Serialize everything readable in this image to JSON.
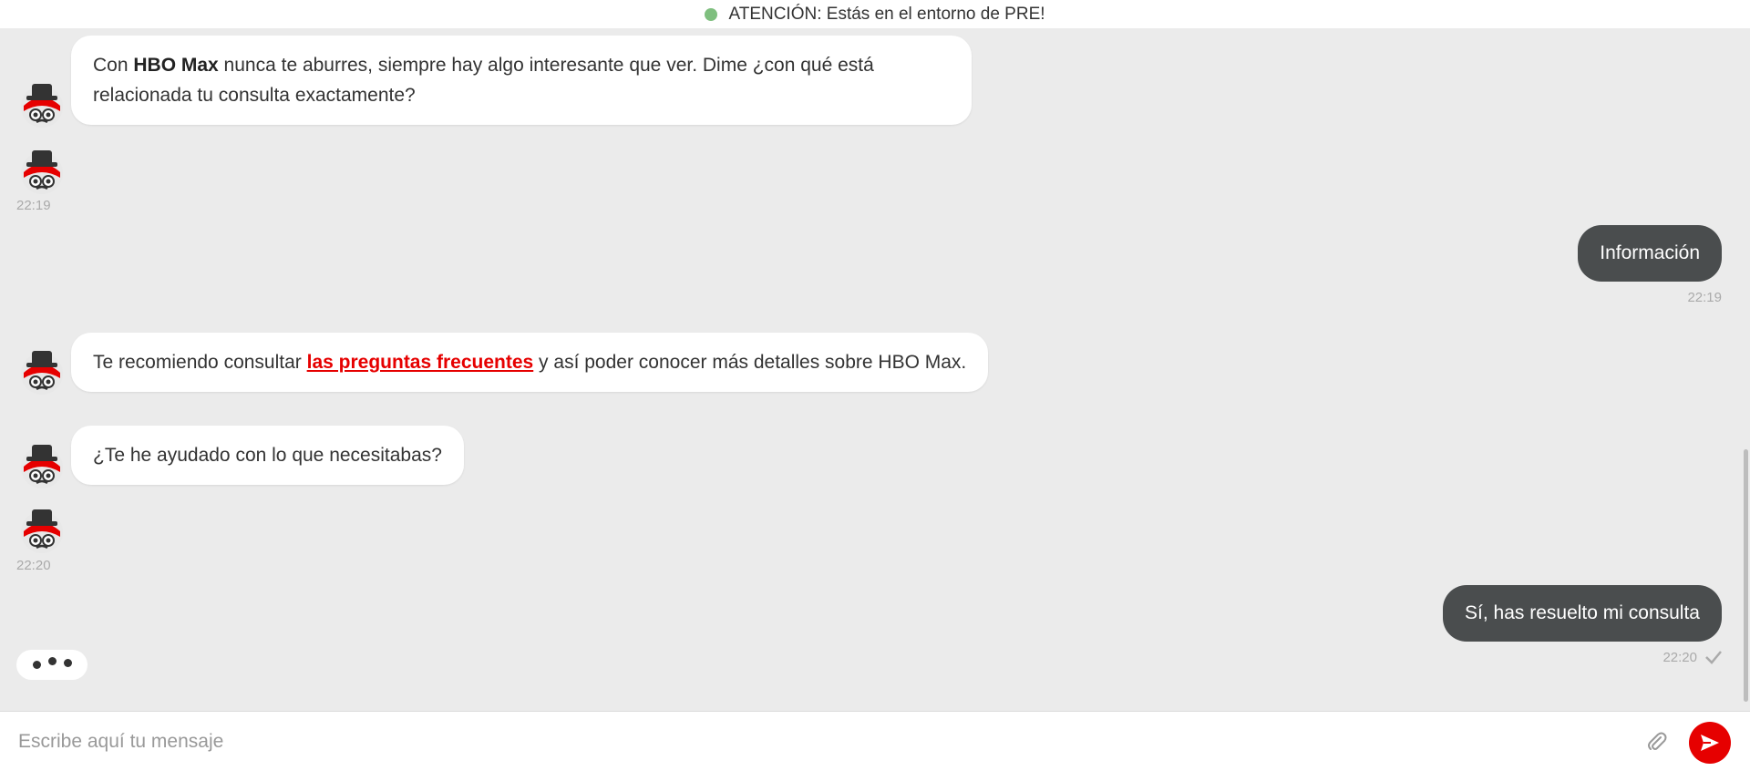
{
  "banner": {
    "text": "ATENCIÓN: Estás en el entorno de PRE!",
    "status_color": "#7fbf7f"
  },
  "messages": [
    {
      "from": "bot",
      "parts": [
        {
          "text": "Con "
        },
        {
          "text": "HBO Max",
          "bold": true
        },
        {
          "text": " nunca te aburres, siempre hay algo interesante que ver. Dime ¿con qué está relacionada tu consulta exactamente?"
        }
      ]
    },
    {
      "from": "bot",
      "time": "22:19"
    },
    {
      "from": "user",
      "text": "Información",
      "time": "22:19"
    },
    {
      "from": "bot",
      "parts": [
        {
          "text": "Te recomiendo consultar "
        },
        {
          "text": "las preguntas frecuentes",
          "link": true
        },
        {
          "text": " y así poder conocer más detalles sobre HBO Max."
        }
      ]
    },
    {
      "from": "bot",
      "text": "¿Te he ayudado con lo que necesitabas?"
    },
    {
      "from": "bot",
      "time": "22:20"
    },
    {
      "from": "user",
      "text": "Sí, has resuelto mi consulta",
      "time": "22:20",
      "status": "check-icon"
    }
  ],
  "composer": {
    "placeholder": "Escribe aquí tu mensaje",
    "value": ""
  },
  "icons": {
    "attach": "paperclip-icon",
    "send": "send-icon"
  },
  "colors": {
    "accent": "#e60000",
    "user_bubble": "#4a4d4e",
    "background": "#ebebeb"
  }
}
